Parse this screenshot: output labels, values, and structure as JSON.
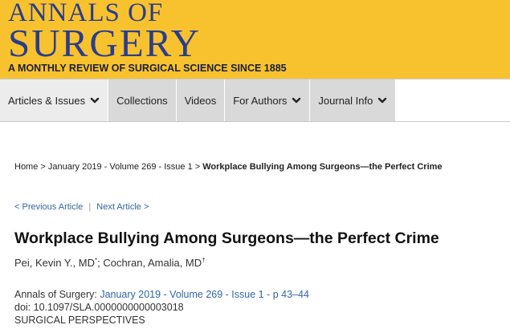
{
  "masthead": {
    "line1": "ANNALS OF",
    "line2": "SURGERY",
    "tagline": "A MONTHLY REVIEW OF SURGICAL SCIENCE SINCE 1885",
    "bg_color": "#f8c22e",
    "title_color": "#2b3d8e"
  },
  "nav": {
    "items": [
      {
        "label": "Articles & Issues",
        "has_dropdown": true,
        "icon": "chevron-down-icon"
      },
      {
        "label": "Collections",
        "has_dropdown": false
      },
      {
        "label": "Videos",
        "has_dropdown": false
      },
      {
        "label": "For Authors",
        "has_dropdown": true,
        "icon": "chevron-down-icon"
      },
      {
        "label": "Journal Info",
        "has_dropdown": true,
        "icon": "chevron-down-icon"
      }
    ]
  },
  "breadcrumb": {
    "home": "Home",
    "sep": ">",
    "issue": "January 2019 - Volume 269 - Issue 1",
    "current": "Workplace Bullying Among Surgeons—the Perfect Crime"
  },
  "article_nav": {
    "previous": "< Previous Article",
    "divider": "|",
    "next": "Next Article >"
  },
  "article": {
    "title": "Workplace Bullying Among Surgeons—the Perfect Crime",
    "author1": "Pei, Kevin Y., MD",
    "author1_mark": "*",
    "author_sep": "; ",
    "author2": "Cochran, Amalia, MD",
    "author2_mark": "†",
    "journal_prefix": "Annals of Surgery: ",
    "issue_link": "January 2019 - Volume 269 - Issue 1 - p 43–44",
    "doi": "doi: 10.1097/SLA.0000000000003018",
    "section": "SURGICAL PERSPECTIVES"
  },
  "colors": {
    "link": "#3465a4",
    "nav_bg": "#d9d9d9"
  }
}
